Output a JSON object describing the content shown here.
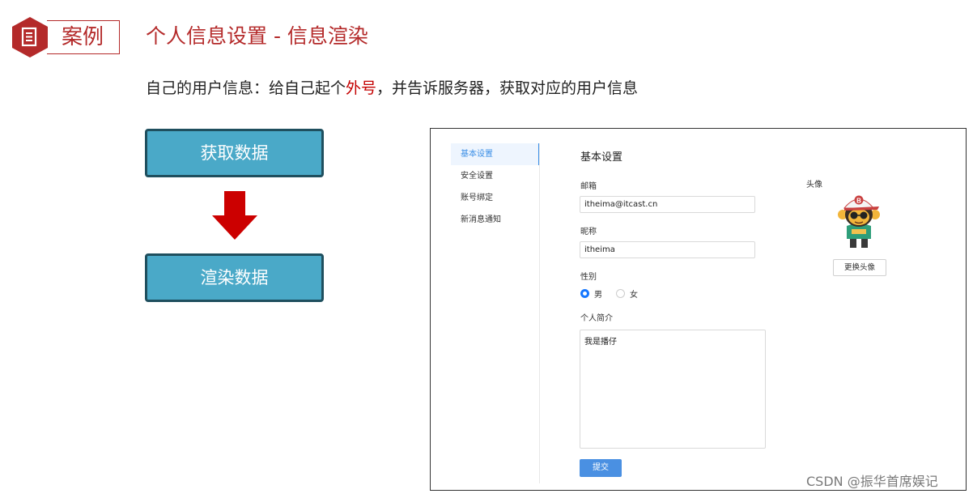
{
  "header": {
    "badge_label": "案例",
    "title": "个人信息设置 - 信息渲染"
  },
  "subtitle": {
    "prefix": "自己的用户信息：给自己起个",
    "highlight": "外号",
    "suffix": "，并告诉服务器，获取对应的用户信息"
  },
  "flow": {
    "step1": "获取数据",
    "step2": "渲染数据"
  },
  "colors": {
    "brand_red": "#b42a2a",
    "highlight_red": "#c40000",
    "flow_box": "#4aa9c8",
    "flow_border": "#1f4f5e",
    "arrow": "#cc0000",
    "accent_blue": "#3a8ee6",
    "submit_blue": "#4a90e2"
  },
  "settings": {
    "nav": [
      {
        "label": "基本设置",
        "active": true
      },
      {
        "label": "安全设置",
        "active": false
      },
      {
        "label": "账号绑定",
        "active": false
      },
      {
        "label": "新消息通知",
        "active": false
      }
    ],
    "form_title": "基本设置",
    "email_label": "邮箱",
    "email_value": "itheima@itcast.cn",
    "nickname_label": "昵称",
    "nickname_value": "itheima",
    "gender_label": "性别",
    "gender_options": [
      "男",
      "女"
    ],
    "gender_selected": "男",
    "bio_label": "个人简介",
    "bio_value": "我是播仔",
    "submit_label": "提交",
    "avatar_label": "头像",
    "avatar_button": "更换头像"
  },
  "watermark": "CSDN @振华首席娱记"
}
